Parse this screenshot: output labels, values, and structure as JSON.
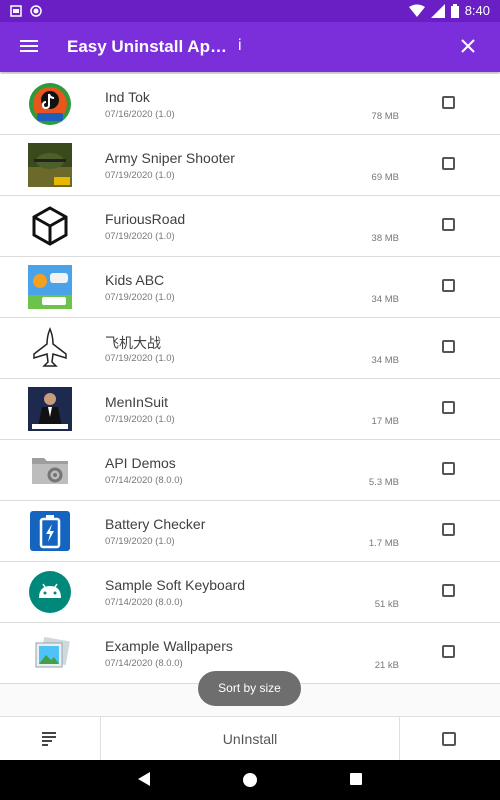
{
  "status_bar": {
    "time": "8:40"
  },
  "app_bar": {
    "title": "Easy Uninstall Ap…",
    "search_text": "i"
  },
  "apps": [
    {
      "name": "Ind Tok",
      "date": "07/16/2020 (1.0)",
      "size": "78 MB",
      "icon": "ind-tok-icon"
    },
    {
      "name": "Army Sniper Shooter",
      "date": "07/19/2020 (1.0)",
      "size": "69 MB",
      "icon": "army-sniper-icon"
    },
    {
      "name": "FuriousRoad",
      "date": "07/19/2020 (1.0)",
      "size": "38 MB",
      "icon": "unity-logo-icon"
    },
    {
      "name": "Kids ABC",
      "date": "07/19/2020 (1.0)",
      "size": "34 MB",
      "icon": "kids-abc-icon"
    },
    {
      "name": "飞机大战",
      "date": "07/19/2020 (1.0)",
      "size": "34 MB",
      "icon": "airplane-icon"
    },
    {
      "name": "MenInSuit",
      "date": "07/19/2020 (1.0)",
      "size": "17 MB",
      "icon": "men-in-suit-icon"
    },
    {
      "name": "API Demos",
      "date": "07/14/2020 (8.0.0)",
      "size": "5.3 MB",
      "icon": "folder-gear-icon"
    },
    {
      "name": "Battery Checker",
      "date": "07/19/2020 (1.0)",
      "size": "1.7 MB",
      "icon": "battery-icon"
    },
    {
      "name": "Sample Soft Keyboard",
      "date": "07/14/2020 (8.0.0)",
      "size": "51 kB",
      "icon": "android-icon"
    },
    {
      "name": "Example Wallpapers",
      "date": "07/14/2020 (8.0.0)",
      "size": "21 kB",
      "icon": "wallpapers-icon"
    }
  ],
  "toast": {
    "text": "Sort by size"
  },
  "bottom_bar": {
    "uninstall_label": "UnInstall"
  },
  "colors": {
    "app_bar": "#7b2fdb",
    "status_bar": "#6a1fc4"
  }
}
